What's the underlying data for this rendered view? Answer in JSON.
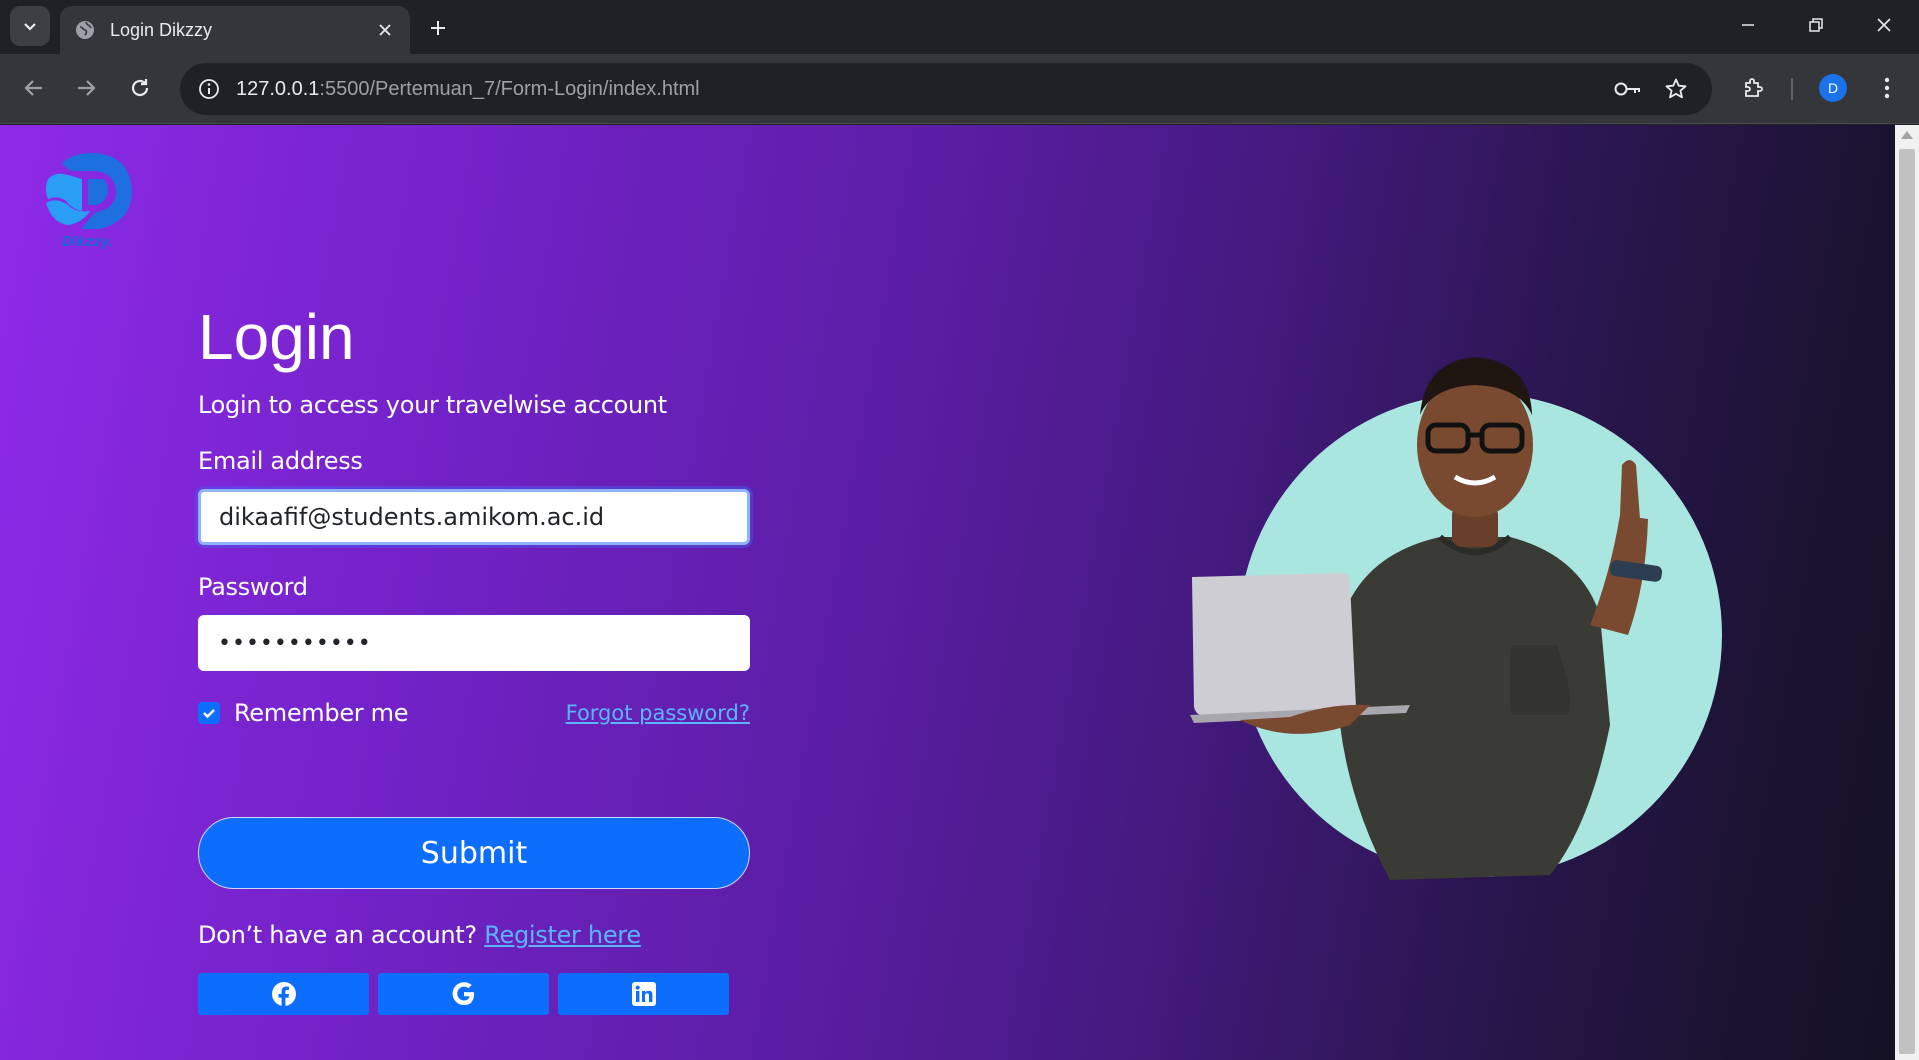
{
  "browser": {
    "tab_title": "Login Dikzzy",
    "url_host": "127.0.0.1",
    "url_path": ":5500/Pertemuan_7/Form-Login/index.html",
    "profile_initial": "D"
  },
  "page": {
    "logo_text": "Dikzzy.",
    "title": "Login",
    "subtitle": "Login to access your travelwise account",
    "email_label": "Email address",
    "email_value": "dikaafif@students.amikom.ac.id",
    "password_label": "Password",
    "password_value": "•••••••••••",
    "remember_label": "Remember me",
    "remember_checked": true,
    "forgot_label": "Forgot password?",
    "submit_label": "Submit",
    "no_account_text": "Don’t have an account? ",
    "register_label": "Register here",
    "social_icons": [
      "facebook-icon",
      "google-icon",
      "linkedin-icon"
    ]
  },
  "colors": {
    "primary": "#0d6efd",
    "link": "#5bb4ff",
    "gradient_start": "#8e2ae8",
    "gradient_end": "#141124",
    "circle": "#a8e6df"
  }
}
